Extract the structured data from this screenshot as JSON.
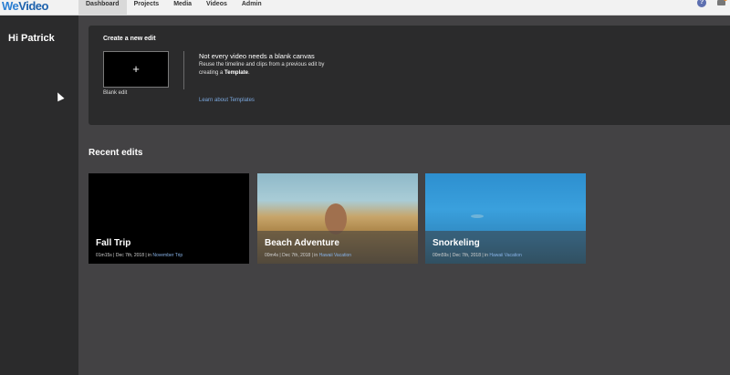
{
  "brand": {
    "logo_a": "We",
    "logo_b": "Video"
  },
  "nav": {
    "items": [
      {
        "label": "Dashboard",
        "active": true
      },
      {
        "label": "Projects",
        "active": false
      },
      {
        "label": "Media",
        "active": false
      },
      {
        "label": "Videos",
        "active": false
      },
      {
        "label": "Admin",
        "active": false
      }
    ],
    "help_glyph": "?"
  },
  "sidebar": {
    "greeting": "Hi Patrick"
  },
  "create": {
    "title": "Create a new edit",
    "blank_label": "Blank edit",
    "plus_glyph": "+",
    "template_heading": "Not every video needs a blank canvas",
    "template_body_1": "Reuse the timeline and clips from a previous edit by creating a ",
    "template_body_bold": "Template",
    "template_body_2": ".",
    "template_link": "Learn about Templates"
  },
  "recent": {
    "title": "Recent edits",
    "cards": [
      {
        "title": "Fall Trip",
        "meta": "01m15s | Dec 7th, 2018 | in ",
        "folder": "November Trip"
      },
      {
        "title": "Beach Adventure",
        "meta": "00m4s | Dec 7th, 2018 | in ",
        "folder": "Hawaii Vacation"
      },
      {
        "title": "Snorkeling",
        "meta": "00m59s | Dec 7th, 2018 | in ",
        "folder": "Hawaii Vacation"
      }
    ]
  },
  "colors": {
    "page_bg": "#434244",
    "panel_bg": "#2b2b2c",
    "link": "#7aa7dd",
    "brand_blue": "#2b7fd3"
  },
  "icons": [
    "help-icon",
    "bell-icon",
    "plus-icon",
    "cursor-icon"
  ]
}
